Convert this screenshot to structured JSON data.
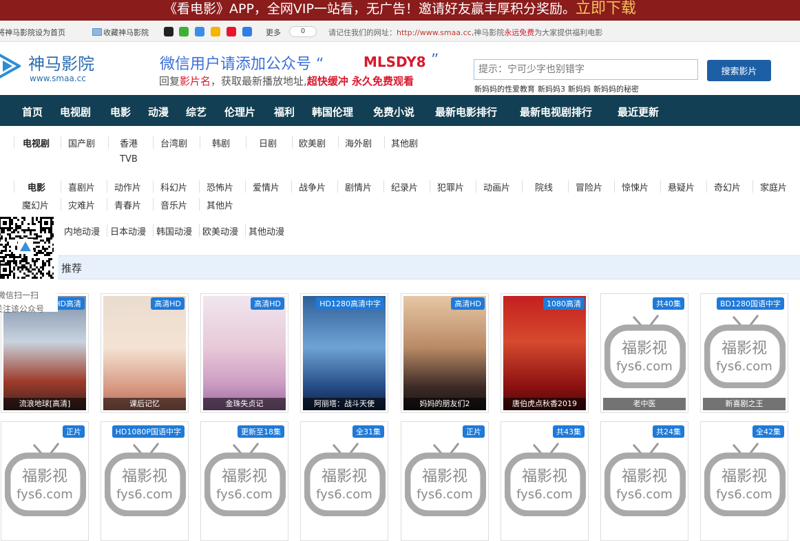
{
  "banner": {
    "text": "《看电影》APP，全网VIP一站看，无广告！邀请好友赢丰厚积分奖励。",
    "cta": "立即下载"
  },
  "infobar": {
    "set_home": "将神马影院设为首页",
    "bookmark": "收藏神马影院",
    "more": "更多",
    "count": "0",
    "remember_prefix": "请记住我们的网址：",
    "url": "http://www.smaa.cc",
    "site_prefix": ",神马影院",
    "forever_free": "永远免费",
    "tail": "为大家提供福利电影"
  },
  "logo": {
    "name": "神马影院",
    "domain": "www.smaa.cc"
  },
  "wechat_ad": {
    "line1": "微信用户请添加公众号 “",
    "code": "MLSDY8",
    "quote_end": "”",
    "line2_a": "回复",
    "line2_b": "影片名",
    "line2_c": "，获取最新播放地址,",
    "line2_d": "超快缓冲 永久免费观看"
  },
  "search": {
    "placeholder": "提示：宁可少字也别错字",
    "button": "搜索影片",
    "hot": [
      "新妈妈的性爱教育",
      "新妈妈3",
      "新妈妈",
      "新妈妈的秘密"
    ]
  },
  "nav": [
    "首页",
    "电视剧",
    "电影",
    "动漫",
    "综艺",
    "伦理片",
    "福利",
    "韩国伦理",
    "免费小说",
    "最新电影排行",
    "最新电视剧排行",
    "最近更新"
  ],
  "categories": {
    "tv_head": "电视剧",
    "tv": [
      "国产剧",
      "香港",
      "TVB",
      "台湾剧",
      "韩剧",
      "日剧",
      "欧美剧",
      "海外剧",
      "其他剧"
    ],
    "movie_head": "电影",
    "movie": [
      "喜剧片",
      "动作片",
      "科幻片",
      "恐怖片",
      "爱情片",
      "战争片",
      "剧情片",
      "纪录片",
      "犯罪片",
      "动画片",
      "院线",
      "冒险片",
      "惊悚片",
      "悬疑片",
      "奇幻片",
      "家庭片",
      "魔幻片",
      "灾难片",
      "青春片",
      "音乐片",
      "其他片"
    ],
    "anime": [
      "内地动漫",
      "日本动漫",
      "韩国动漫",
      "欧美动漫",
      "其他动漫"
    ]
  },
  "qr": {
    "line1": "微信扫一扫",
    "line2": "关注该公众号"
  },
  "recommend": {
    "title": "推荐"
  },
  "placeholder_logo": {
    "cn": "福影视",
    "en": "fys6.com"
  },
  "row1": [
    {
      "badge": "HD高清",
      "title": "流浪地球[高清]"
    },
    {
      "badge": "高清HD",
      "title": "课后记忆"
    },
    {
      "badge": "高清HD",
      "title": "金珠失贞记"
    },
    {
      "badge": "HD1280高清中字",
      "title": "阿丽塔：战斗天使"
    },
    {
      "badge": "高清HD",
      "title": "妈妈的朋友们2"
    },
    {
      "badge": "1080高清",
      "title": "唐伯虎点秋香2019"
    },
    {
      "badge": "共40集",
      "title": "老中医"
    },
    {
      "badge": "BD1280国语中字",
      "title": "新喜剧之王"
    }
  ],
  "row2": [
    {
      "badge": "正片"
    },
    {
      "badge": "HD1080P国语中字"
    },
    {
      "badge": "更新至18集"
    },
    {
      "badge": "全31集"
    },
    {
      "badge": "正片"
    },
    {
      "badge": "共43集"
    },
    {
      "badge": "共24集"
    },
    {
      "badge": "全42集"
    }
  ],
  "colors": {
    "banner": "#8b1c1c",
    "nav": "#123f53",
    "accent": "#1f7ad8",
    "red": "#d8182d"
  }
}
